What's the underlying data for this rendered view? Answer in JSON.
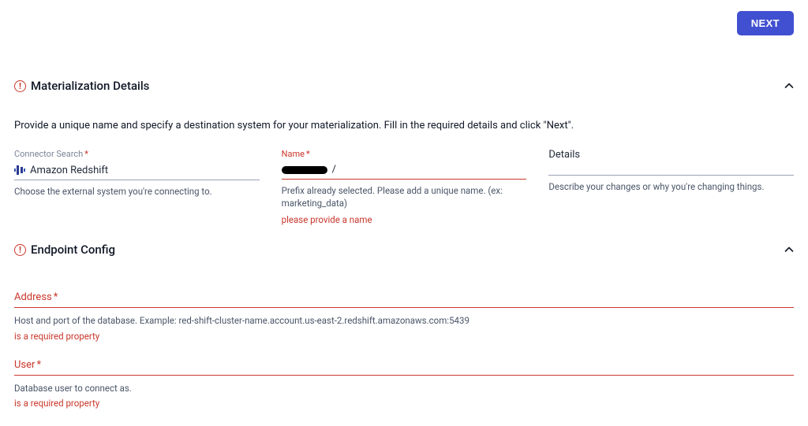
{
  "topbar": {
    "next_label": "NEXT"
  },
  "section1": {
    "title": "Materialization Details",
    "description": "Provide a unique name and specify a destination system for your materialization. Fill in the required details and click \"Next\".",
    "connector": {
      "label": "Connector Search",
      "required_mark": "*",
      "value": "Amazon Redshift",
      "help": "Choose the external system you're connecting to."
    },
    "name": {
      "label": "Name",
      "required_mark": "*",
      "separator": "/",
      "help": "Prefix already selected. Please add a unique name. (ex: marketing_data)",
      "error": "please provide a name"
    },
    "details": {
      "label": "Details",
      "help": "Describe your changes or why you're changing things."
    }
  },
  "section2": {
    "title": "Endpoint Config",
    "address": {
      "label": "Address",
      "required_mark": "*",
      "help": "Host and port of the database. Example: red-shift-cluster-name.account.us-east-2.redshift.amazonaws.com:5439",
      "error": "is a required property"
    },
    "user": {
      "label": "User",
      "required_mark": "*",
      "help": "Database user to connect as.",
      "error": "is a required property"
    }
  }
}
